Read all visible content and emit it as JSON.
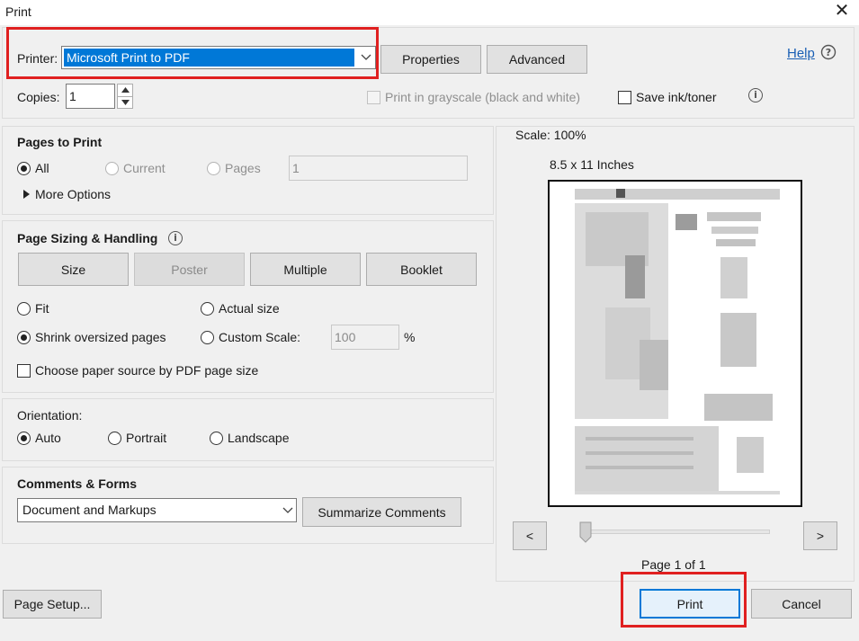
{
  "window": {
    "title": "Print",
    "close_glyph": "✕"
  },
  "top": {
    "printer_label": "Printer:",
    "printer_value": "Microsoft Print to PDF",
    "properties_label": "Properties",
    "advanced_label": "Advanced",
    "help_label": "Help",
    "copies_label": "Copies:",
    "copies_value": "1",
    "grayscale_label": "Print in grayscale (black and white)",
    "save_ink_label": "Save ink/toner"
  },
  "pages_to_print": {
    "title": "Pages to Print",
    "all_label": "All",
    "current_label": "Current",
    "pages_label": "Pages",
    "pages_value": "1",
    "more_options_label": "More Options"
  },
  "page_sizing": {
    "title": "Page Sizing & Handling",
    "size_label": "Size",
    "poster_label": "Poster",
    "multiple_label": "Multiple",
    "booklet_label": "Booklet",
    "fit_label": "Fit",
    "actual_size_label": "Actual size",
    "shrink_label": "Shrink oversized pages",
    "custom_scale_label": "Custom Scale:",
    "custom_scale_value": "100",
    "percent_label": "%",
    "paper_source_label": "Choose paper source by PDF page size"
  },
  "orientation": {
    "title": "Orientation:",
    "auto_label": "Auto",
    "portrait_label": "Portrait",
    "landscape_label": "Landscape"
  },
  "comments_forms": {
    "title": "Comments & Forms",
    "select_value": "Document and Markups",
    "summarize_label": "Summarize Comments"
  },
  "preview": {
    "scale_label": "Scale: 100%",
    "paper_label": "8.5 x 11 Inches",
    "prev_label": "<",
    "next_label": ">",
    "page_label": "Page 1 of 1"
  },
  "footer": {
    "page_setup_label": "Page Setup...",
    "print_label": "Print",
    "cancel_label": "Cancel"
  },
  "colors": {
    "highlight_red": "#e02020",
    "selection_blue": "#0078d7"
  }
}
